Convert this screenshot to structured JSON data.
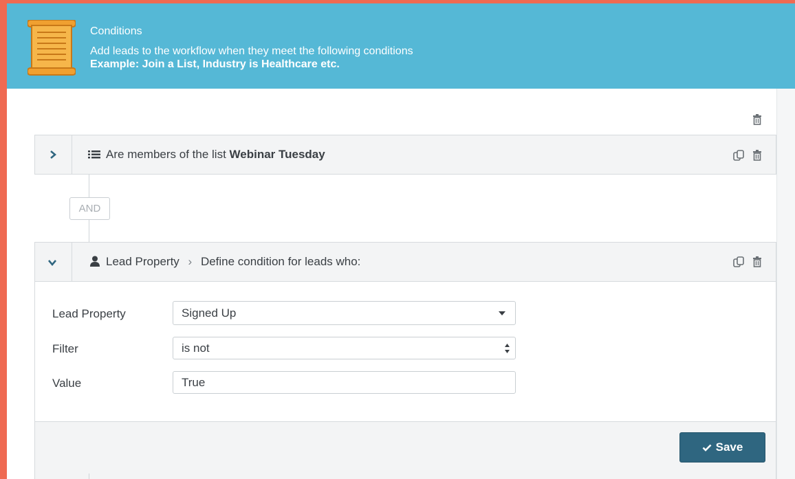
{
  "header": {
    "title": "Conditions",
    "line1": "Add leads to the workflow when they meet the following conditions",
    "line2": "Example: Join a List, Industry is Healthcare etc.",
    "icon": "scroll-icon",
    "color": "#55b8d6"
  },
  "conditions": [
    {
      "prefix": "Are",
      "text": " members of the list ",
      "list_name": "Webinar Tuesday",
      "icon": "list-icon",
      "expanded": false
    },
    {
      "category": "Lead Property",
      "separator": "›",
      "text": "Define condition for leads who:",
      "icon": "user-icon",
      "expanded": true
    }
  ],
  "connector": {
    "label": "AND"
  },
  "form": {
    "lead_property": {
      "label": "Lead Property",
      "value": "Signed Up"
    },
    "filter": {
      "label": "Filter",
      "value": "is not"
    },
    "value": {
      "label": "Value",
      "value": "True"
    }
  },
  "save_button": {
    "label": "Save",
    "color": "#2f6680"
  },
  "accent": "#ef6a52"
}
